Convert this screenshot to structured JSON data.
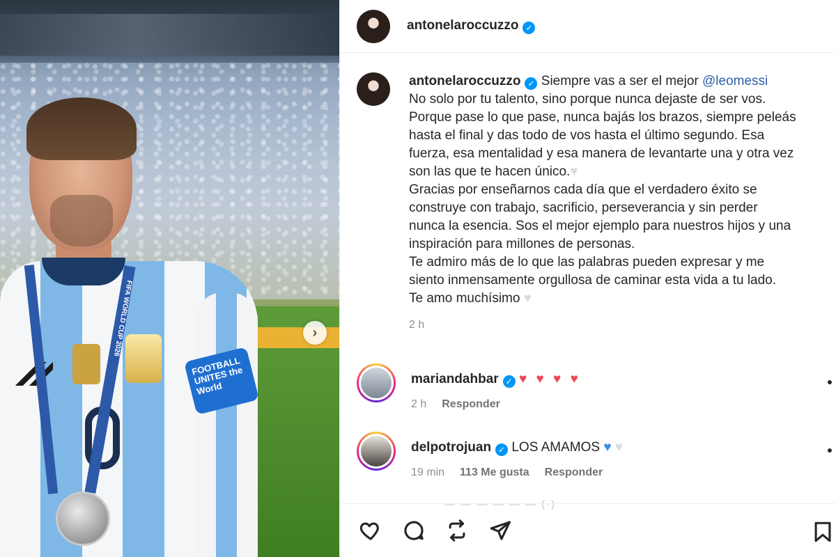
{
  "post": {
    "author": "antonelaroccuzzo",
    "caption_lines": [
      "No solo por tu talento, sino porque nunca dejaste de ser vos.",
      "Porque pase lo que pase, nunca bajás los brazos, siempre peleás",
      "hasta el final y das todo de vos hasta el último segundo. Esa",
      "fuerza, esa mentalidad y esa manera de levantarte una y otra vez",
      "son las que te hacen único."
    ],
    "caption_lead": "Siempre vas a ser el mejor",
    "caption_mention": "@leomessi",
    "caption_lines2": [
      "Gracias por enseñarnos cada día que el verdadero éxito se",
      "construye con trabajo, sacrificio, perseverancia y sin perder",
      "nunca la esencia. Sos el mejor ejemplo para nuestros hijos y una",
      "inspiración para millones de personas.",
      "Te admiro más de lo que las palabras pueden expresar y me",
      "siento inmensamente orgullosa de caminar esta vida a tu lado.",
      "Te amo muchísimo"
    ],
    "time": "2 h"
  },
  "photo": {
    "armband_text": "FOOTBALL UNITES the World",
    "lanyard_text": "FIFA WORLD CUP 2026"
  },
  "comments": [
    {
      "username": "mariandahbar",
      "text": "♥ ♥ ♥ ♥",
      "time": "2 h",
      "reply": "Responder"
    },
    {
      "username": "delpotrojuan",
      "text": "LOS AMAMOS",
      "time": "19 min",
      "likes": "113 Me gusta",
      "reply": "Responder"
    }
  ],
  "icons": {
    "verified": "✓",
    "white_heart": "♥",
    "blue_heart": "♥",
    "carousel_next": "›"
  },
  "colors": {
    "accent_blue": "#0095f6",
    "mention": "#2f5fa7",
    "red_heart": "#ed4956"
  }
}
